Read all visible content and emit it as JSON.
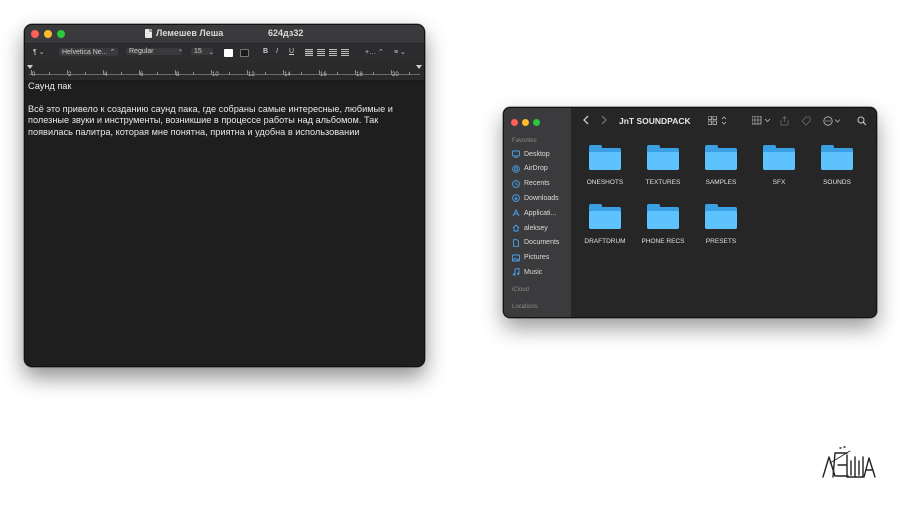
{
  "textedit": {
    "title_left": "Лемешев Леша",
    "title_right": "624дз32",
    "toolbar": {
      "paragraph_style": "¶",
      "font_family": "Helvetica Ne...",
      "font_style": "Regular",
      "font_size": "15",
      "bold": "B",
      "italic": "I",
      "underline": "U",
      "spacing": "+…",
      "list": "≡"
    },
    "ruler_numbers": [
      "0",
      "2",
      "4",
      "6",
      "8",
      "10",
      "12",
      "14",
      "16",
      "18",
      "20"
    ],
    "heading": "Саунд пак",
    "body": "Всё это привело к созданию саунд пака, где собраны самые интересные, любимые и полезные звуки и инструменты, возникшие в процессе работы над альбомом. Так появилась палитра, которая мне понятна, приятна и удобна в использовании"
  },
  "finder": {
    "title": "JnT SOUNDPACK",
    "sidebar": {
      "favorites_header": "Favorites",
      "items": [
        {
          "label": "Desktop",
          "icon": "desktop-icon"
        },
        {
          "label": "AirDrop",
          "icon": "airdrop-icon"
        },
        {
          "label": "Recents",
          "icon": "clock-icon"
        },
        {
          "label": "Downloads",
          "icon": "download-icon"
        },
        {
          "label": "Applicati...",
          "icon": "applications-icon"
        },
        {
          "label": "aleksey",
          "icon": "home-icon"
        },
        {
          "label": "Documents",
          "icon": "document-icon"
        },
        {
          "label": "Pictures",
          "icon": "picture-icon"
        },
        {
          "label": "Music",
          "icon": "music-icon"
        }
      ],
      "icloud_header": "iCloud",
      "locations_header": "Locations"
    },
    "folders": [
      "ONESHOTS",
      "TEXTURES",
      "SAMPLES",
      "SFX",
      "SOUNDS",
      "DRAFTDRUM",
      "PHONE RECS",
      "PRESETS"
    ],
    "colors": {
      "folder": "#5ec2ff",
      "sidebar_icon": "#4aa3f0"
    }
  },
  "signature": {
    "text": "ЛЕША"
  }
}
